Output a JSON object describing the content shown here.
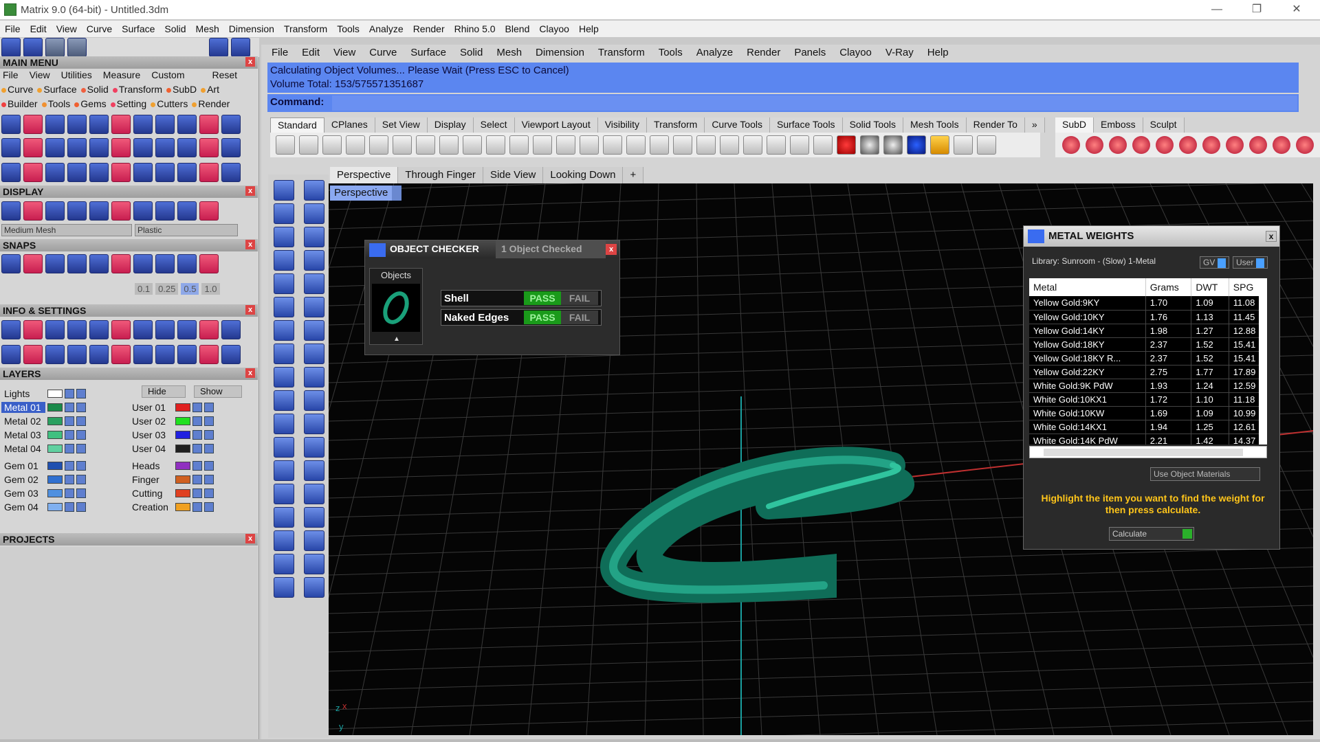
{
  "window": {
    "title": "Matrix 9.0 (64-bit) - Untitled.3dm",
    "minimize": "—",
    "maximize": "❐",
    "close": "✕"
  },
  "menu_main": [
    "File",
    "Edit",
    "View",
    "Curve",
    "Surface",
    "Solid",
    "Mesh",
    "Dimension",
    "Transform",
    "Tools",
    "Analyze",
    "Render",
    "Rhino 5.0",
    "Blend",
    "Clayoo",
    "Help"
  ],
  "left": {
    "main_menu_title": "MAIN MENU",
    "mm_menu": [
      "File",
      "View",
      "Utilities",
      "Measure",
      "Custom",
      "Reset"
    ],
    "mm_cats_row1": [
      {
        "label": "Curve",
        "color": "#f0a030"
      },
      {
        "label": "Surface",
        "color": "#f0a030"
      },
      {
        "label": "Solid",
        "color": "#f06040"
      },
      {
        "label": "Transform",
        "color": "#f04060"
      },
      {
        "label": "SubD",
        "color": "#f06030"
      },
      {
        "label": "Art",
        "color": "#f0a030"
      }
    ],
    "mm_cats_row2": [
      {
        "label": "Builder",
        "color": "#f04040"
      },
      {
        "label": "Tools",
        "color": "#f09030"
      },
      {
        "label": "Gems",
        "color": "#f06030"
      },
      {
        "label": "Setting",
        "color": "#f04060"
      },
      {
        "label": "Cutters",
        "color": "#f0a030"
      },
      {
        "label": "Render",
        "color": "#f0a030"
      }
    ],
    "display_title": "DISPLAY",
    "display_mesh": "Medium Mesh",
    "display_material": "Plastic",
    "snaps_title": "SNAPS",
    "snap_values": [
      "0.1",
      "0.25",
      "0.5",
      "1.0"
    ],
    "info_title": "INFO & SETTINGS",
    "layers_title": "LAYERS",
    "layers_hide": "Hide",
    "layers_show": "Show",
    "layers_left": [
      {
        "name": "Lights",
        "color": "#ffffff"
      },
      {
        "name": "Metal 01",
        "color": "#1a8a4a",
        "selected": true
      },
      {
        "name": "Metal 02",
        "color": "#2aa060"
      },
      {
        "name": "Metal 03",
        "color": "#40c080"
      },
      {
        "name": "Metal 04",
        "color": "#60d0a0"
      },
      {
        "name": "Gem 01",
        "color": "#2050b0"
      },
      {
        "name": "Gem 02",
        "color": "#3070d0"
      },
      {
        "name": "Gem 03",
        "color": "#5090e0"
      },
      {
        "name": "Gem 04",
        "color": "#80b0f0"
      }
    ],
    "layers_right": [
      {
        "name": "User 01",
        "color": "#e02020"
      },
      {
        "name": "User 02",
        "color": "#20e020"
      },
      {
        "name": "User 03",
        "color": "#2020e0"
      },
      {
        "name": "User 04",
        "color": "#202020"
      },
      {
        "name": "Heads",
        "color": "#9030c0"
      },
      {
        "name": "Finger",
        "color": "#d06020"
      },
      {
        "name": "Cutting",
        "color": "#e04020"
      },
      {
        "name": "Creation",
        "color": "#f0a020"
      }
    ],
    "projects_title": "PROJECTS"
  },
  "menu_rhino": [
    "File",
    "Edit",
    "View",
    "Curve",
    "Surface",
    "Solid",
    "Mesh",
    "Dimension",
    "Transform",
    "Tools",
    "Analyze",
    "Render",
    "Panels",
    "Clayoo",
    "V-Ray",
    "Help"
  ],
  "command": {
    "line1": "Calculating Object Volumes... Please Wait (Press ESC to Cancel)",
    "line2": "Volume Total: 153/575571351687",
    "prompt": "Command:"
  },
  "toolbar_tabs": [
    "Standard",
    "CPlanes",
    "Set View",
    "Display",
    "Select",
    "Viewport Layout",
    "Visibility",
    "Transform",
    "Curve Tools",
    "Surface Tools",
    "Solid Tools",
    "Mesh Tools",
    "Render To"
  ],
  "toolbar_more": "»",
  "right_tabs": [
    "SubD",
    "Emboss",
    "Sculpt"
  ],
  "viewport_tabs": [
    "Perspective",
    "Through Finger",
    "Side View",
    "Looking Down"
  ],
  "viewport_add": "+",
  "viewport_label": "Perspective",
  "axis": {
    "x": "x",
    "y": "y",
    "z": "z"
  },
  "checker": {
    "title": "OBJECT CHECKER",
    "status": "1 Object Checked",
    "objects_label": "Objects",
    "collapse": "▲",
    "rows": [
      {
        "name": "Shell",
        "pass": "PASS",
        "fail": "FAIL"
      },
      {
        "name": "Naked Edges",
        "pass": "PASS",
        "fail": "FAIL"
      }
    ]
  },
  "metal": {
    "title": "METAL WEIGHTS",
    "library": "Library: Sunroom - (Slow) 1-Metal",
    "gv": "GV",
    "user": "User",
    "columns": [
      "Metal",
      "Grams",
      "DWT",
      "SPG"
    ],
    "rows": [
      [
        "Yellow Gold:9KY",
        "1.70",
        "1.09",
        "11.08"
      ],
      [
        "Yellow Gold:10KY",
        "1.76",
        "1.13",
        "11.45"
      ],
      [
        "Yellow Gold:14KY",
        "1.98",
        "1.27",
        "12.88"
      ],
      [
        "Yellow Gold:18KY",
        "2.37",
        "1.52",
        "15.41"
      ],
      [
        "Yellow Gold:18KY R...",
        "2.37",
        "1.52",
        "15.41"
      ],
      [
        "Yellow Gold:22KY",
        "2.75",
        "1.77",
        "17.89"
      ],
      [
        "White Gold:9K PdW",
        "1.93",
        "1.24",
        "12.59"
      ],
      [
        "White Gold:10KX1",
        "1.72",
        "1.10",
        "11.18"
      ],
      [
        "White Gold:10KW",
        "1.69",
        "1.09",
        "10.99"
      ],
      [
        "White Gold:14KX1",
        "1.94",
        "1.25",
        "12.61"
      ],
      [
        "White Gold:14K PdW",
        "2.21",
        "1.42",
        "14.37"
      ]
    ],
    "use_object_materials": "Use Object Materials",
    "hint": "Highlight the item you want to find the weight for then press calculate.",
    "calculate": "Calculate"
  }
}
